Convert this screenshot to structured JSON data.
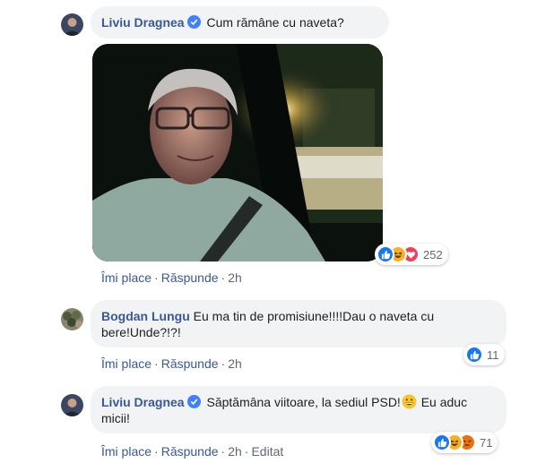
{
  "comments": [
    {
      "author": "Liviu Dragnea",
      "verified": true,
      "text": "Cum rămâne cu naveta?",
      "actions": {
        "like": "Îmi place",
        "reply": "Răspunde",
        "time": "2h"
      },
      "reactions": {
        "icons": [
          "like-icon",
          "haha-icon",
          "love-icon"
        ],
        "count": "252"
      }
    },
    {
      "author": "Bogdan Lungu",
      "verified": false,
      "text": "Eu ma tin de promisiune!!!!Dau o naveta cu bere!Unde?!?!",
      "actions": {
        "like": "Îmi place",
        "reply": "Răspunde",
        "time": "2h"
      },
      "reactions": {
        "icons": [
          "like-icon"
        ],
        "count": "11"
      }
    },
    {
      "author": "Liviu Dragnea",
      "verified": true,
      "text": "Săptămâna viitoare, la sediul PSD!",
      "text_after_emoji": " Eu aduc micii!",
      "actions": {
        "like": "Îmi place",
        "reply": "Răspunde",
        "time": "2h",
        "edited": "Editat"
      },
      "reactions": {
        "icons": [
          "like-icon",
          "haha-icon",
          "angry-icon"
        ],
        "count": "71"
      }
    }
  ],
  "colors": {
    "bubble": "#f2f3f5",
    "author": "#385898",
    "like_blue": "#1877f2",
    "love_red": "#f33e58",
    "haha_yellow": "#f7b125",
    "angry_orange": "#e9710f"
  }
}
